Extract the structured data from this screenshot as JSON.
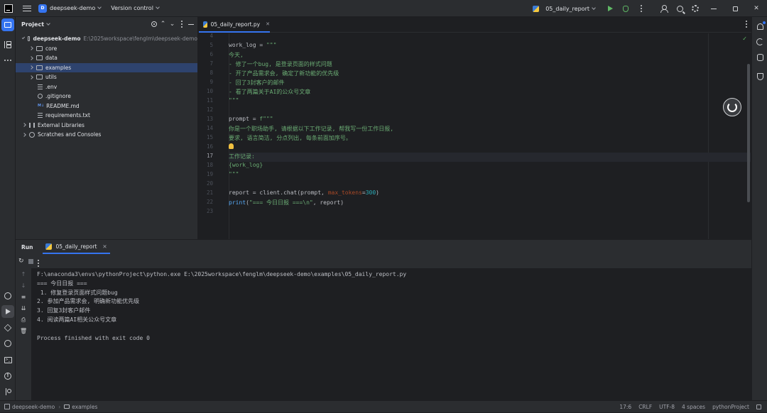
{
  "titlebar": {
    "project_badge": "D",
    "project_name": "deepseek-demo",
    "vcs_label": "Version control",
    "run_config": "05_daily_report"
  },
  "project_panel": {
    "title": "Project",
    "root_name": "deepseek-demo",
    "root_path": "E:\\2025workspace\\fenglm\\deepseek-demo",
    "items": [
      {
        "name": "core"
      },
      {
        "name": "data"
      },
      {
        "name": "examples"
      },
      {
        "name": "utils"
      }
    ],
    "files": [
      {
        "name": ".env"
      },
      {
        "name": ".gitignore"
      },
      {
        "name": "README.md",
        "badge": "M↓"
      },
      {
        "name": "requirements.txt"
      }
    ],
    "external_libraries": "External Libraries",
    "scratches": "Scratches and Consoles"
  },
  "editor": {
    "tab_label": "05_daily_report.py",
    "line_numbers": [
      "4",
      "5",
      "6",
      "7",
      "8",
      "9",
      "10",
      "11",
      "12",
      "13",
      "14",
      "15",
      "16",
      "17",
      "18",
      "19",
      "20",
      "21",
      "22",
      "23"
    ],
    "current_line": "17",
    "code": {
      "l5_a": "work_log = ",
      "l5_b": "\"\"\"",
      "l6": "今天,",
      "l7": "- 修了一个bug, 是登录页面的样式问题",
      "l8": "- 开了产品需求会, 确定了新功能的优先级",
      "l9": "- 回了3封客户的邮件",
      "l10": "- 看了两篇关于AI的公众号文章",
      "l11": "\"\"\"",
      "l13_a": "prompt = ",
      "l13_b": "f\"\"\"",
      "l14": "你是一个职场助手, 请根据以下工作记录, 帮我写一份工作日报,",
      "l15": "要求, 语言简洁, 分点列出, 每条前面加序号。",
      "l17": "工作记录:",
      "l18": "{work_log}",
      "l19": "\"\"\"",
      "l21_a": "report = client.chat(prompt, ",
      "l21_b": "max_tokens",
      "l21_c": "=",
      "l21_d": "300",
      "l21_e": ")",
      "l22_a": "print",
      "l22_b": "(",
      "l22_c": "\"=== 今日日报 ===\\n\"",
      "l22_d": ", report)"
    }
  },
  "run_panel": {
    "title": "Run",
    "tab_label": "05_daily_report",
    "console_lines": [
      "F:\\anaconda3\\envs\\pythonProject\\python.exe E:\\2025workspace\\fenglm\\deepseek-demo\\examples\\05_daily_report.py",
      "=== 今日日报 ===",
      " 1. 修复登录页面样式问题bug",
      "2. 参加产品需求会, 明确新功能优先级",
      "3. 回复3封客户邮件",
      "4. 阅读两篇AI相关公众号文章",
      "",
      "Process finished with exit code 0"
    ]
  },
  "statusbar": {
    "crumb_project": "deepseek-demo",
    "crumb_folder": "examples",
    "position": "17:6",
    "line_sep": "CRLF",
    "encoding": "UTF-8",
    "indent": "4 spaces",
    "interpreter": "pythonProject"
  },
  "colors": {
    "accent": "#3574f0",
    "string": "#6aab73",
    "keyword": "#56a8f5",
    "number": "#2aacb8",
    "param": "#aa4926"
  }
}
